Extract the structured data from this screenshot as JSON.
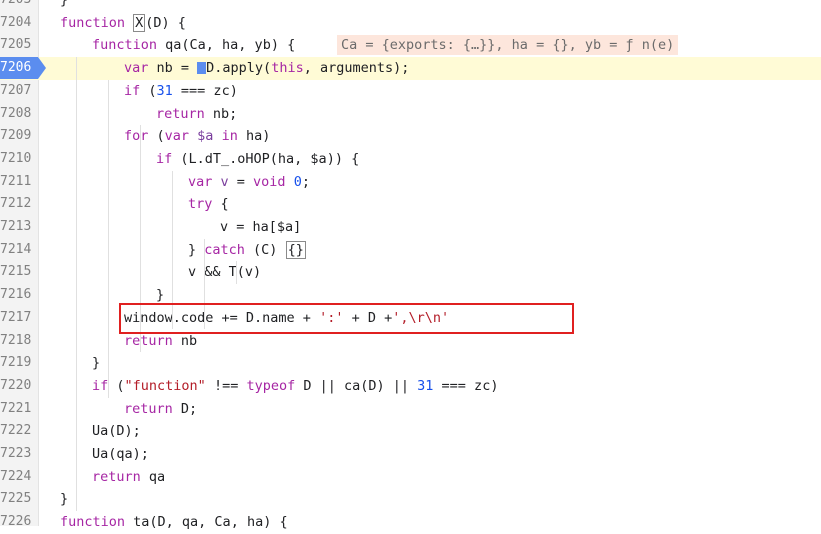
{
  "lines": [
    {
      "num": "7203",
      "parts": [
        [
          "plain",
          "}"
        ]
      ],
      "indent": 1
    },
    {
      "num": "7204",
      "parts": [
        [
          "kw",
          "function "
        ],
        [
          "plain",
          "X"
        ],
        [
          "plain",
          "(D) {"
        ]
      ],
      "indent": 1
    },
    {
      "num": "7205",
      "parts": [
        [
          "kw",
          "function "
        ],
        [
          "plain",
          "qa(Ca, ha, yb) {"
        ]
      ],
      "indent": 2,
      "inline": "Ca = {exports: {…}}, ha = {}, yb = ƒ n(e)"
    },
    {
      "num": "7206",
      "parts": [
        [
          "kw",
          "var "
        ],
        [
          "plain",
          "nb = "
        ],
        [
          "plain",
          "D.apply("
        ],
        [
          "kw",
          "this"
        ],
        [
          "plain",
          ", arguments);"
        ]
      ],
      "indent": 3,
      "paused": true
    },
    {
      "num": "7207",
      "parts": [
        [
          "kw",
          "if "
        ],
        [
          "plain",
          "("
        ],
        [
          "num",
          "31"
        ],
        [
          "plain",
          " === zc)"
        ]
      ],
      "indent": 3
    },
    {
      "num": "7208",
      "parts": [
        [
          "kw",
          "return "
        ],
        [
          "plain",
          "nb;"
        ]
      ],
      "indent": 4
    },
    {
      "num": "7209",
      "parts": [
        [
          "kw",
          "for "
        ],
        [
          "plain",
          "("
        ],
        [
          "kw",
          "var "
        ],
        [
          "var",
          "$a "
        ],
        [
          "kw",
          "in "
        ],
        [
          "plain",
          "ha)"
        ]
      ],
      "indent": 3
    },
    {
      "num": "7210",
      "parts": [
        [
          "kw",
          "if "
        ],
        [
          "plain",
          "(L.dT_.oHOP(ha, $a)) {"
        ]
      ],
      "indent": 4
    },
    {
      "num": "7211",
      "parts": [
        [
          "kw",
          "var "
        ],
        [
          "var",
          "v "
        ],
        [
          "plain",
          "= "
        ],
        [
          "kw",
          "void "
        ],
        [
          "num",
          "0"
        ],
        [
          "plain",
          ";"
        ]
      ],
      "indent": 5
    },
    {
      "num": "7212",
      "parts": [
        [
          "kw",
          "try "
        ],
        [
          "plain",
          "{"
        ]
      ],
      "indent": 5
    },
    {
      "num": "7213",
      "parts": [
        [
          "plain",
          "v = ha[$a]"
        ]
      ],
      "indent": 6
    },
    {
      "num": "7214",
      "parts": [
        [
          "plain",
          "} "
        ],
        [
          "kw",
          "catch "
        ],
        [
          "plain",
          "(C) "
        ],
        [
          "plain",
          "{}"
        ]
      ],
      "indent": 5
    },
    {
      "num": "7215",
      "parts": [
        [
          "plain",
          "v && T(v)"
        ]
      ],
      "indent": 5
    },
    {
      "num": "7216",
      "parts": [
        [
          "plain",
          "}"
        ]
      ],
      "indent": 4
    },
    {
      "num": "7217",
      "parts": [
        [
          "plain",
          "window.code += D.name + "
        ],
        [
          "str",
          "':'"
        ],
        [
          "plain",
          " + D +"
        ],
        [
          "str",
          "',\\r\\n'"
        ]
      ],
      "indent": 3
    },
    {
      "num": "7218",
      "parts": [
        [
          "kw",
          "return "
        ],
        [
          "plain",
          "nb"
        ]
      ],
      "indent": 3
    },
    {
      "num": "7219",
      "parts": [
        [
          "plain",
          "}"
        ]
      ],
      "indent": 2
    },
    {
      "num": "7220",
      "parts": [
        [
          "kw",
          "if "
        ],
        [
          "plain",
          "("
        ],
        [
          "str",
          "\"function\""
        ],
        [
          "plain",
          " !== "
        ],
        [
          "kw",
          "typeof "
        ],
        [
          "plain",
          "D || ca(D) || "
        ],
        [
          "num",
          "31"
        ],
        [
          "plain",
          " === zc)"
        ]
      ],
      "indent": 2
    },
    {
      "num": "7221",
      "parts": [
        [
          "kw",
          "return "
        ],
        [
          "plain",
          "D;"
        ]
      ],
      "indent": 3
    },
    {
      "num": "7222",
      "parts": [
        [
          "plain",
          "Ua(D);"
        ]
      ],
      "indent": 2
    },
    {
      "num": "7223",
      "parts": [
        [
          "plain",
          "Ua(qa);"
        ]
      ],
      "indent": 2
    },
    {
      "num": "7224",
      "parts": [
        [
          "kw",
          "return "
        ],
        [
          "plain",
          "qa"
        ]
      ],
      "indent": 2
    },
    {
      "num": "7225",
      "parts": [
        [
          "plain",
          "}"
        ]
      ],
      "indent": 1
    },
    {
      "num": "7226",
      "parts": [
        [
          "kw",
          "function "
        ],
        [
          "plain",
          "ta(D, qa, Ca, ha) {"
        ]
      ],
      "indent": 1
    }
  ]
}
